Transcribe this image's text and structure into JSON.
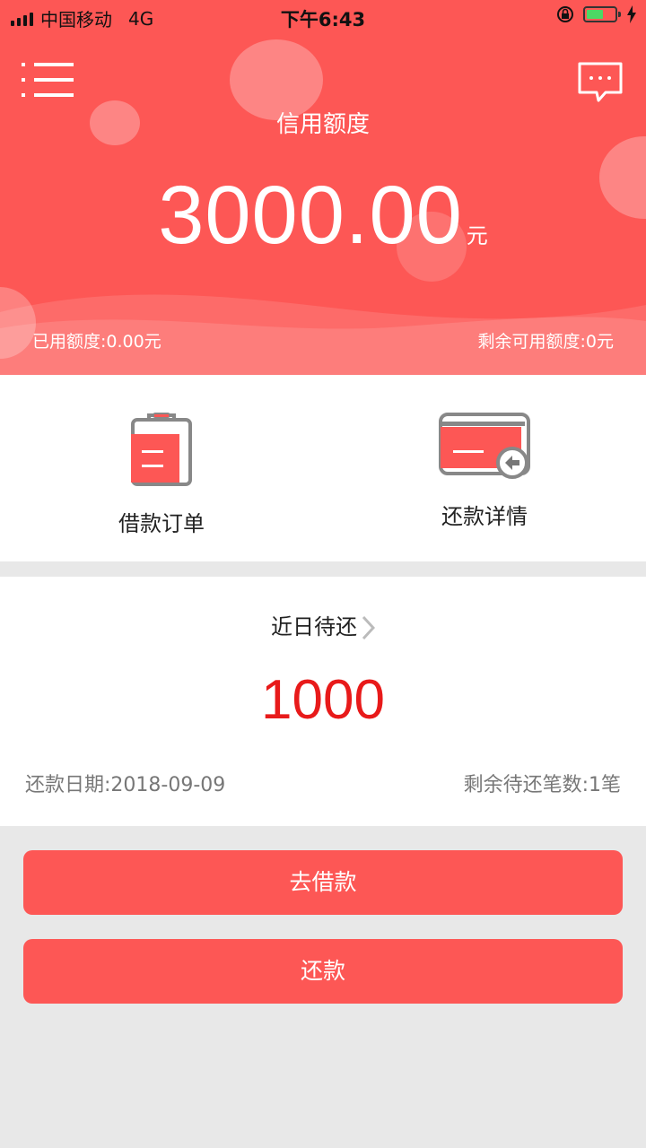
{
  "status_bar": {
    "carrier": "中国移动",
    "network": "4G",
    "time": "下午6:43"
  },
  "header": {
    "menu_icon": "menu-icon",
    "message_icon": "message-icon",
    "credit_label": "信用额度",
    "credit_amount": "3000.00",
    "credit_unit": "元",
    "used_credit": "已用额度:0.00元",
    "remaining_credit": "剩余可用额度:0元"
  },
  "actions": [
    {
      "label": "借款订单",
      "icon": "clipboard-icon"
    },
    {
      "label": "还款详情",
      "icon": "card-return-icon"
    }
  ],
  "recent": {
    "title": "近日待还",
    "amount": "1000",
    "repay_date": "还款日期:2018-09-09",
    "remaining_count": "剩余待还笔数:1笔"
  },
  "buttons": {
    "borrow": "去借款",
    "repay": "还款"
  },
  "colors": {
    "brand": "#fd5755",
    "amount_red": "#e81a1a",
    "background": "#e8e8e8"
  }
}
